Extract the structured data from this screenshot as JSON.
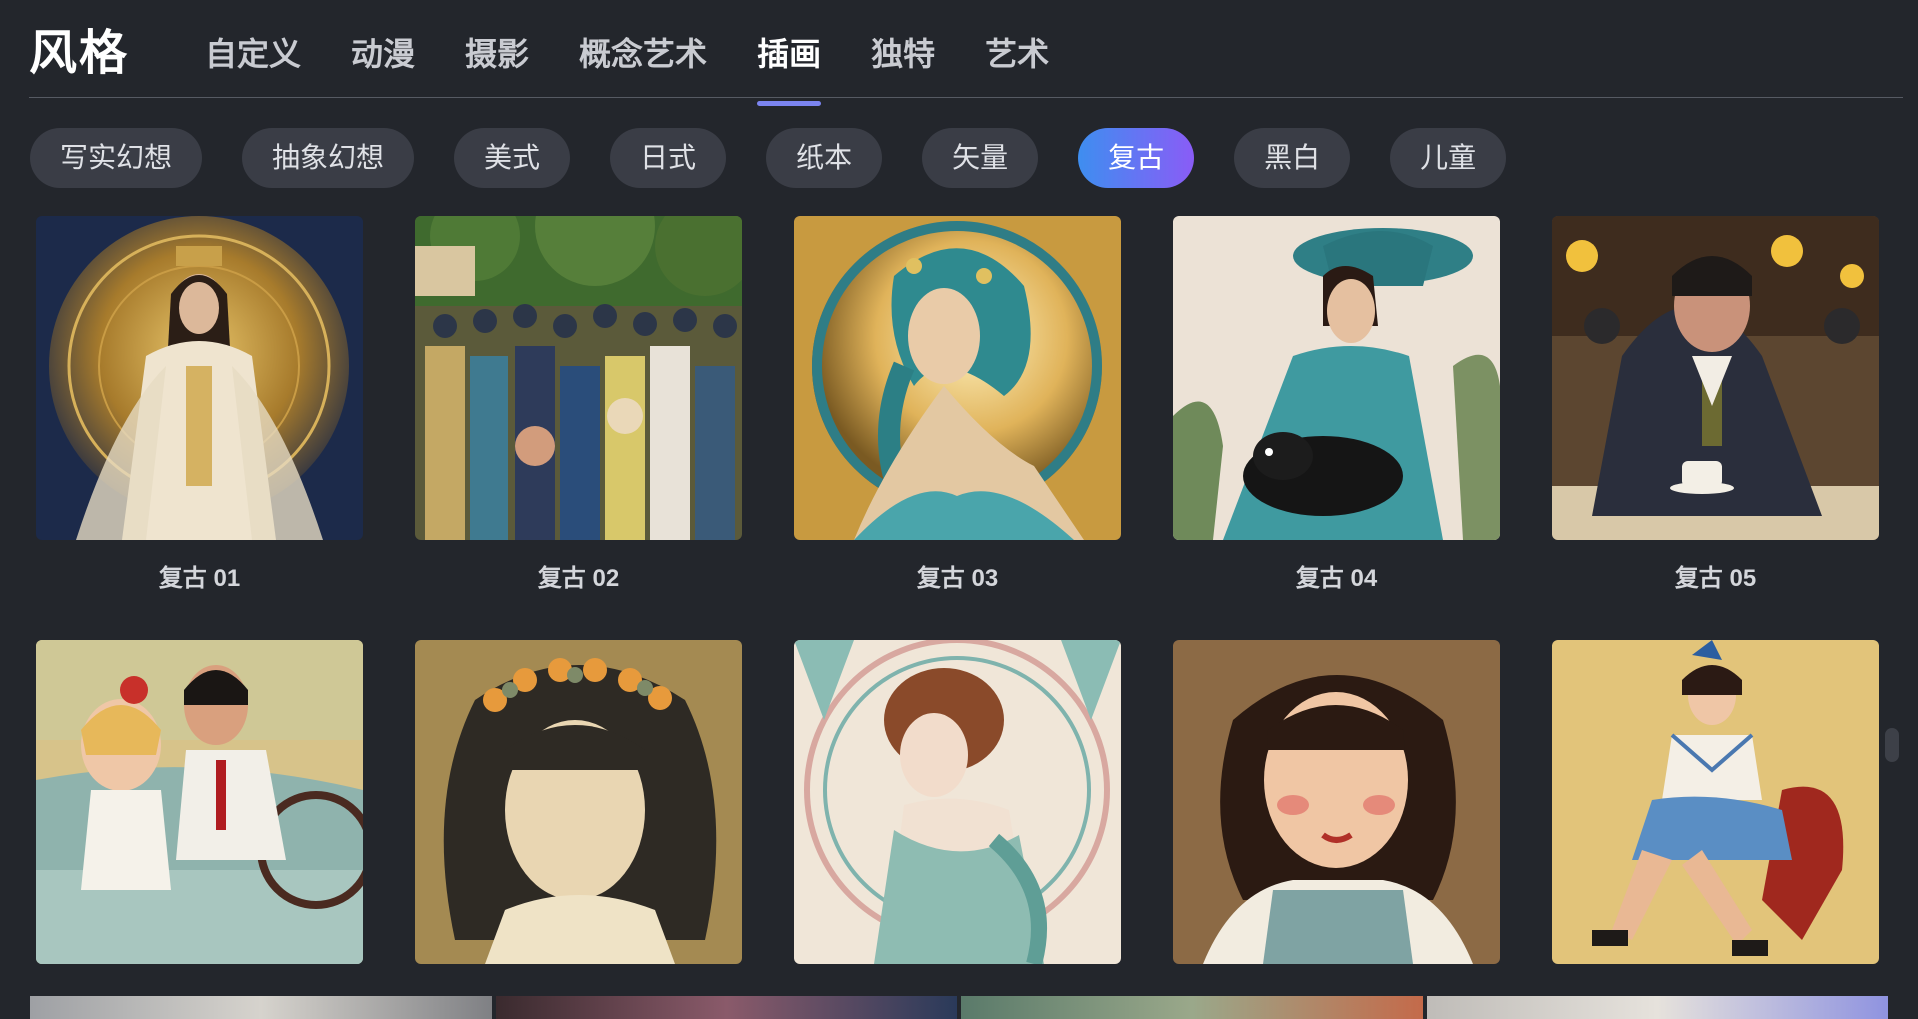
{
  "header": {
    "title": "风格",
    "tabs": [
      {
        "label": "自定义"
      },
      {
        "label": "动漫"
      },
      {
        "label": "摄影"
      },
      {
        "label": "概念艺术"
      },
      {
        "label": "插画",
        "active": true
      },
      {
        "label": "独特"
      },
      {
        "label": "艺术"
      }
    ]
  },
  "chips": [
    {
      "label": "写实幻想"
    },
    {
      "label": "抽象幻想"
    },
    {
      "label": "美式"
    },
    {
      "label": "日式"
    },
    {
      "label": "纸本"
    },
    {
      "label": "矢量"
    },
    {
      "label": "复古",
      "active": true
    },
    {
      "label": "黑白"
    },
    {
      "label": "儿童"
    }
  ],
  "gallery": {
    "items": [
      {
        "caption": "复古 01"
      },
      {
        "caption": "复古 02"
      },
      {
        "caption": "复古 03"
      },
      {
        "caption": "复古 04"
      },
      {
        "caption": "复古 05"
      },
      {
        "caption": ""
      },
      {
        "caption": ""
      },
      {
        "caption": ""
      },
      {
        "caption": ""
      },
      {
        "caption": ""
      }
    ]
  },
  "colors": {
    "background": "#23262c",
    "chip": "#3a3d46",
    "chip_active_gradient": [
      "#3e8ef0",
      "#8a5cf6"
    ],
    "tab_underline": "#7b84f0"
  }
}
